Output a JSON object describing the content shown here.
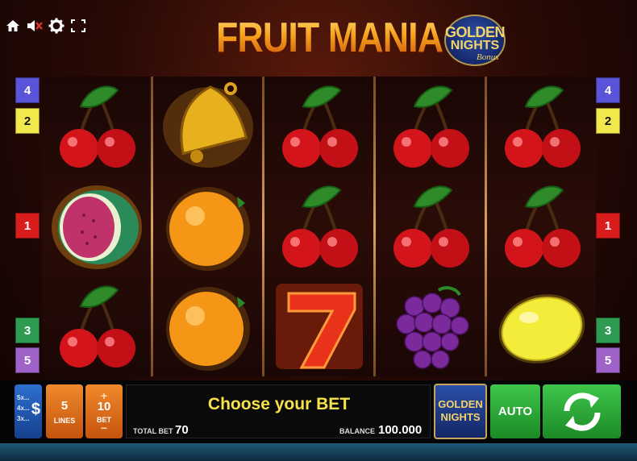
{
  "header": {
    "title": "FRUIT MANIA",
    "badge": {
      "line1": "GOLDEN",
      "line2": "NIGHTS",
      "line3": "Bonus"
    }
  },
  "top_icons": [
    "home-icon",
    "sound-muted-icon",
    "gear-icon",
    "fullscreen-icon"
  ],
  "reels": [
    [
      "cherry",
      "watermelon",
      "cherry"
    ],
    [
      "bell",
      "orange",
      "orange"
    ],
    [
      "cherry",
      "cherry",
      "seven"
    ],
    [
      "cherry",
      "cherry",
      "grapes"
    ],
    [
      "cherry",
      "cherry",
      "lemon"
    ]
  ],
  "line_markers": {
    "left": [
      "4",
      "2",
      "1",
      "3",
      "5"
    ],
    "right": [
      "4",
      "2",
      "1",
      "3",
      "5"
    ]
  },
  "controls": {
    "paytable": {
      "rows": [
        "5x...",
        "4x...",
        "3x..."
      ],
      "symbol": "$"
    },
    "lines": {
      "value": "5",
      "label": "LINES"
    },
    "bet": {
      "plus": "+",
      "value": "10",
      "label": "BET",
      "minus": "−"
    },
    "message": "Choose your BET",
    "total_bet_label": "TOTAL BET",
    "total_bet_value": "70",
    "balance_label": "BALANCE",
    "balance_value": "100.000",
    "gn_button": {
      "line1": "GOLDEN",
      "line2": "NIGHTS"
    },
    "auto_label": "AUTO"
  },
  "colors": {
    "accent_orange": "#f08a2c",
    "accent_green": "#3ec64a",
    "message_yellow": "#f7e24a"
  }
}
